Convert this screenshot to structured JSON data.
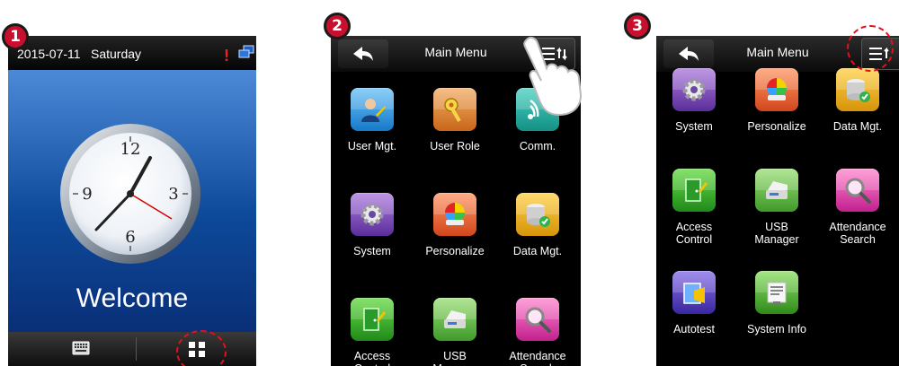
{
  "steps": [
    "1",
    "2",
    "3"
  ],
  "panel1": {
    "date": "2015-07-11",
    "day": "Saturday",
    "alert": "!",
    "welcome": "Welcome",
    "icons": [
      "network-icon",
      "keyboard-icon",
      "menu-icon",
      "clock"
    ]
  },
  "panel2": {
    "title": "Main Menu",
    "back_icon": "back-arrow-icon",
    "options_icon": "sort-list-icon",
    "apps": [
      {
        "label": "User Mgt.",
        "icon": "user-mgt-icon"
      },
      {
        "label": "User Role",
        "icon": "key-icon"
      },
      {
        "label": "Comm.",
        "icon": "comm-icon"
      },
      {
        "label": "System",
        "icon": "gear-icon"
      },
      {
        "label": "Personalize",
        "icon": "color-wheel-icon"
      },
      {
        "label": "Data Mgt.",
        "icon": "database-icon"
      },
      {
        "label": "Access\nControl",
        "icon": "door-icon"
      },
      {
        "label": "USB\nManager",
        "icon": "usb-drive-icon"
      },
      {
        "label": "Attendance\nSearch",
        "icon": "magnifier-icon"
      }
    ]
  },
  "panel3": {
    "title": "Main Menu",
    "apps": [
      {
        "label": "System",
        "icon": "gear-icon"
      },
      {
        "label": "Personalize",
        "icon": "color-wheel-icon"
      },
      {
        "label": "Data Mgt.",
        "icon": "database-icon"
      },
      {
        "label": "Access\nControl",
        "icon": "door-icon"
      },
      {
        "label": "USB\nManager",
        "icon": "usb-drive-icon"
      },
      {
        "label": "Attendance\nSearch",
        "icon": "magnifier-icon"
      },
      {
        "label": "Autotest",
        "icon": "autotest-icon"
      },
      {
        "label": "System Info",
        "icon": "system-info-icon"
      }
    ]
  },
  "colors": {
    "badge": "#c8102e",
    "highlight_dash": "#e3111b",
    "welcome_bg_top": "#4c8ad8",
    "welcome_bg_bottom": "#0a2f78"
  }
}
